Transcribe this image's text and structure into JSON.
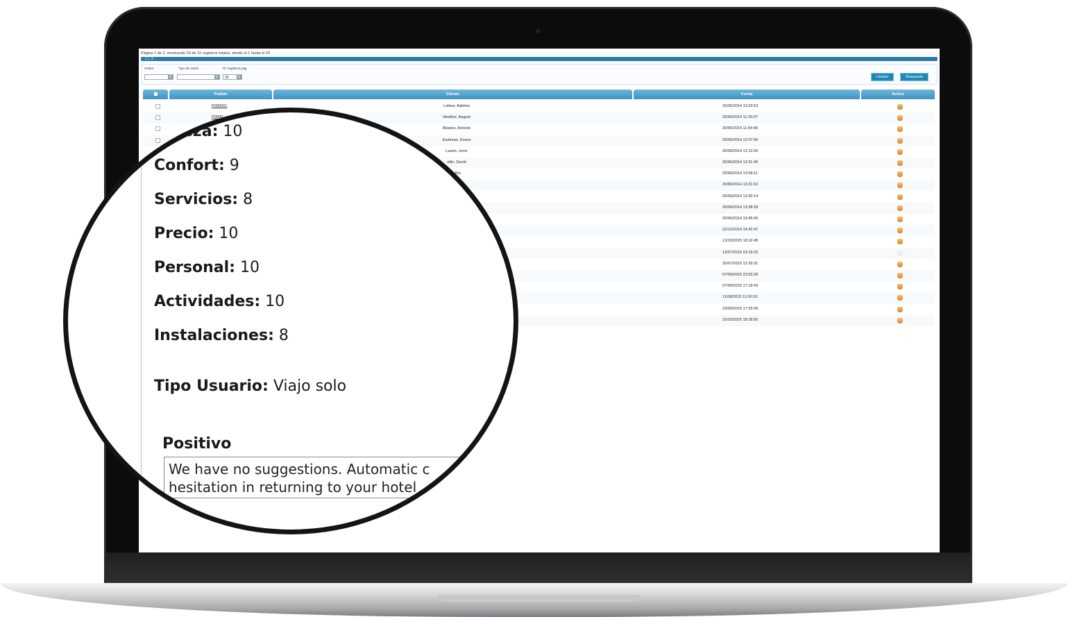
{
  "list": {
    "page_info": "Página 1 de 2, mostrando 20 de 31 registros totales, desde el 1 hasta el 20",
    "pages": [
      "1",
      "2"
    ],
    "filters": {
      "orden_label": "Orden",
      "orden_value": "",
      "tipo_label": "Tipo de orden",
      "tipo_value": "",
      "registros_label": "Nº registros pág.",
      "registros_value": "20"
    },
    "buttons": {
      "limpiar": "Limpiar",
      "busqueda": "Búsqueda"
    },
    "columns": {
      "pedido": "Pedido",
      "cliente": "Cliente",
      "fecha": "Fecha",
      "activo": "Activo"
    },
    "rows": [
      {
        "pedido": "P000001",
        "cliente": "Lekker, Adeline",
        "fecha": "20/06/2014 10:23:53",
        "activo": true
      },
      {
        "pedido": "P0000",
        "cliente": "Heather, August",
        "fecha": "20/06/2014 11:25:07",
        "activo": true
      },
      {
        "pedido": "",
        "cliente": "Álvarez, Antonio",
        "fecha": "20/06/2014 11:54:48",
        "activo": true
      },
      {
        "pedido": "",
        "cliente": "Eastman, Evans",
        "fecha": "20/06/2014 12:07:06",
        "activo": true
      },
      {
        "pedido": "",
        "cliente": "Lastre, Irene",
        "fecha": "20/06/2014 12:13:30",
        "activo": true
      },
      {
        "pedido": "",
        "cliente": "ellin, David",
        "fecha": "20/06/2014 12:21:45",
        "activo": true
      },
      {
        "pedido": "",
        "cliente": ", Roi",
        "fecha": "20/06/2014 13:09:11",
        "activo": true
      },
      {
        "pedido": "",
        "cliente": "",
        "fecha": "20/06/2014 13:21:52",
        "activo": true
      },
      {
        "pedido": "",
        "cliente": "",
        "fecha": "20/06/2014 13:30:14",
        "activo": true
      },
      {
        "pedido": "",
        "cliente": "",
        "fecha": "20/06/2014 13:38:28",
        "activo": true
      },
      {
        "pedido": "",
        "cliente": "",
        "fecha": "20/06/2014 13:45:05",
        "activo": true
      },
      {
        "pedido": "",
        "cliente": "",
        "fecha": "22/12/2014 14:42:47",
        "activo": true
      },
      {
        "pedido": "",
        "cliente": "",
        "fecha": "13/10/2015 18:12:45",
        "activo": true
      },
      {
        "pedido": "",
        "cliente": "",
        "fecha": "12/07/2015 23:19:25",
        "activo": false
      },
      {
        "pedido": "",
        "cliente": "",
        "fecha": "20/07/2015 12:29:31",
        "activo": true
      },
      {
        "pedido": "",
        "cliente": "",
        "fecha": "07/09/2015 23:03:26",
        "activo": true
      },
      {
        "pedido": "",
        "cliente": "",
        "fecha": "07/09/2015 17:19:43",
        "activo": true
      },
      {
        "pedido": "",
        "cliente": "",
        "fecha": "11/08/2015 11:00:19",
        "activo": true
      },
      {
        "pedido": "",
        "cliente": "",
        "fecha": "23/09/2015 17:33:36",
        "activo": true
      },
      {
        "pedido": "",
        "cliente": "",
        "fecha": "15/10/2015 18:18:50",
        "activo": true
      }
    ]
  },
  "magnifier": {
    "ratings": [
      {
        "label": "eza:",
        "value": "10"
      },
      {
        "label": "Confort:",
        "value": "9"
      },
      {
        "label": "Servicios:",
        "value": "8"
      },
      {
        "label": "Precio:",
        "value": "10"
      },
      {
        "label": "Personal:",
        "value": "10"
      },
      {
        "label": "Actividades:",
        "value": "10"
      },
      {
        "label": "Instalaciones:",
        "value": "8"
      }
    ],
    "tipo_usuario_label": "Tipo Usuario:",
    "tipo_usuario_value": "Viajo solo",
    "positivo_title": "Positivo",
    "positivo_lines": [
      "We have no suggestions. Automatic c",
      "hesitation in returning to your hotel"
    ]
  },
  "colors": {
    "header": "#3f93c3",
    "pager": "#2a7cad",
    "button": "#1f86b5",
    "thumb": "#d4862e"
  }
}
